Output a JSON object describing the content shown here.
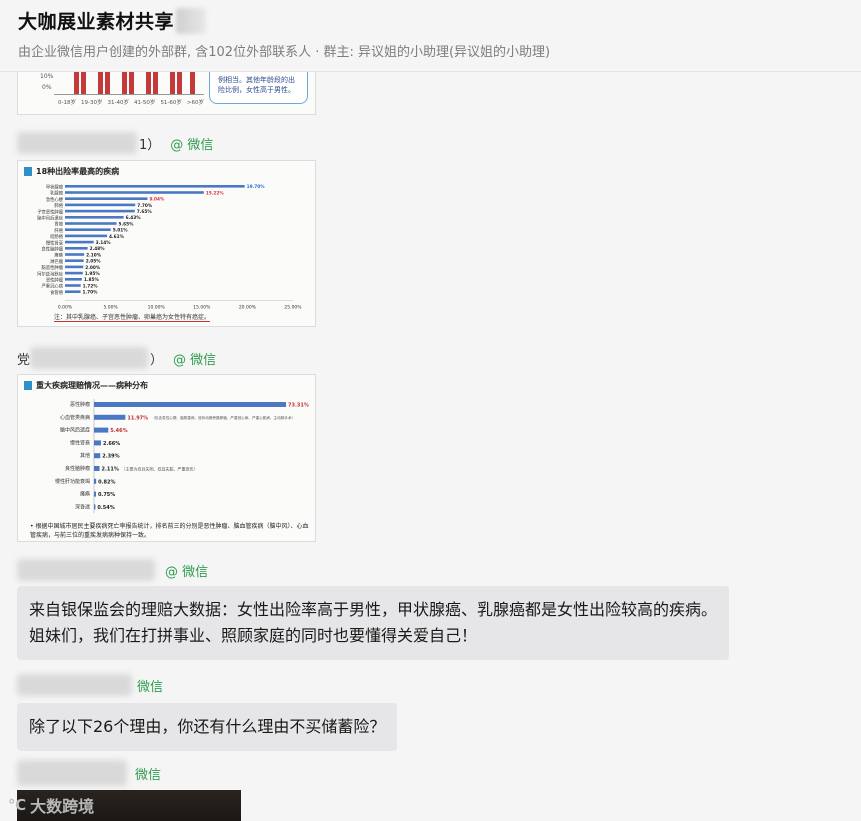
{
  "header": {
    "title": "大咖展业素材共享",
    "subtitle": "由企业微信用户创建的外部群, 含102位外部联系人 · 群主: 异议姐的小助理(异议姐的小助理)"
  },
  "messages": [
    {
      "type": "image",
      "kind": "age-chart-crop",
      "y_ticks": [
        "10%",
        "0%"
      ],
      "x_labels": [
        "0-18岁",
        "19-30岁",
        "31-40岁",
        "41-50岁",
        "51-60岁",
        ">60岁"
      ],
      "callout": [
        "例相当。其他年龄段的出",
        "险比例，女性高于男性。"
      ]
    },
    {
      "type": "sender",
      "name_suffix": "1）",
      "source": "@ 微信"
    },
    {
      "type": "image",
      "kind": "chart",
      "chart_data": {
        "type": "bar",
        "orientation": "horizontal",
        "title": "18种出险率最高的疾病",
        "categories": [
          "甲状腺癌",
          "乳腺癌",
          "急性心梗",
          "肺癌",
          "子宫恶性肿瘤",
          "脑中风后遗症",
          "胃癌",
          "肝癌",
          "结肠癌",
          "慢性肾衰",
          "良性脑肿瘤",
          "瘫痪",
          "淋巴瘤",
          "脑恶性肿瘤",
          "阿尔兹海默症",
          "恶性肿瘤",
          "严重冠心病",
          "食管癌"
        ],
        "values": [
          19.7,
          15.22,
          9.04,
          7.7,
          7.65,
          6.43,
          5.65,
          5.01,
          4.61,
          3.14,
          2.48,
          2.1,
          2.05,
          2.0,
          1.95,
          1.85,
          1.72,
          1.7
        ],
        "data_labels": [
          "19.70%",
          "15.22%",
          "9.04%",
          "7.70%",
          "7.65%",
          "6.43%",
          "5.65%",
          "5.01%",
          "4.61%",
          "3.14%",
          "2.48%",
          "2.10%",
          "2.05%",
          "2.00%",
          "1.95%",
          "1.85%",
          "1.72%",
          "1.70%"
        ],
        "xlim": [
          0,
          25
        ],
        "x_ticks": [
          "0.00%",
          "5.00%",
          "10.00%",
          "15.00%",
          "20.00%",
          "25.00%"
        ],
        "highlight_colors": [
          "#2f6bd1",
          "#d6333a"
        ],
        "bar_color": "#4a78c2",
        "note": "注：其中乳腺癌、子宫恶性肿瘤、卵巢癌为女性特有癌症。"
      }
    },
    {
      "type": "sender",
      "name_prefix": "党",
      "name_suffix": "）",
      "source": "@ 微信"
    },
    {
      "type": "image",
      "kind": "chart",
      "chart_data": {
        "type": "bar",
        "orientation": "horizontal",
        "title": "重大疾病理赔情况——病种分布",
        "categories": [
          "恶性肿瘤",
          "心血管类疾病",
          "脑中风后遗症",
          "慢性肾衰",
          "其他",
          "良性脑肿瘤",
          "慢性肝功能衰竭",
          "瘫痪",
          "深昏迷"
        ],
        "values": [
          73.31,
          11.97,
          5.46,
          2.66,
          2.39,
          2.11,
          0.82,
          0.75,
          0.54
        ],
        "data_labels": [
          "73.31%",
          "11.97%",
          "5.46%",
          "2.66%",
          "2.39%",
          "2.11%",
          "0.82%",
          "0.75%",
          "0.54%"
        ],
        "annotations": [
          "（包含急性心梗、脑脓重病、冠状动脉旁路移植、严重冠心病、严重心肌病、主动脉手术）",
          "（主要为双目失明、双耳失聪、严重烧伤）"
        ],
        "footnote": "• 根据中国城市居民主要疾病死亡率报告统计，排名前三的分别是恶性肿瘤、脑血管疾病（脑中风）、心血管疾病，与前三位的重疾发病病种保持一致。",
        "bar_color": "#4a78c2",
        "label_color": "#c0302f"
      }
    },
    {
      "type": "sender",
      "source": "@ 微信"
    },
    {
      "type": "text",
      "text": "来自银保监会的理赔大数据：女性出险率高于男性，甲状腺癌、乳腺癌都是女性出险较高的疾病。姐妹们，我们在打拼事业、照顾家庭的同时也要懂得关爱自己！"
    },
    {
      "type": "sender",
      "source": "微信"
    },
    {
      "type": "text",
      "text": "除了以下26个理由，你还有什么理由不买储蓄险？"
    },
    {
      "type": "sender",
      "source": "微信"
    }
  ],
  "watermark": {
    "logo": "℃",
    "text": "大数跨境"
  },
  "colors": {
    "bubble": "#e6e6e8",
    "wechat_green": "#2e9d4e",
    "page_bg": "#f5f5f5"
  }
}
